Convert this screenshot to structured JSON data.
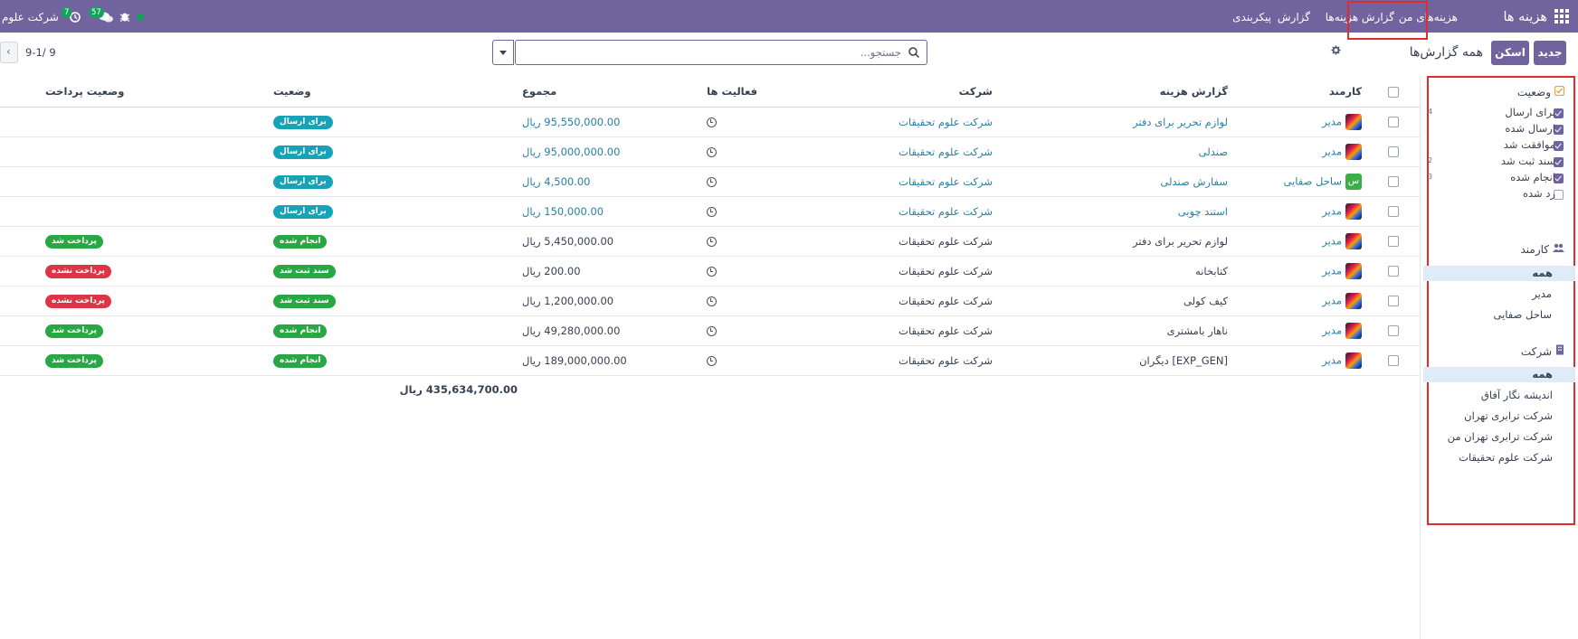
{
  "navbar": {
    "brand": "هزینه ها",
    "menu": [
      "هزینه‌های من",
      "گزارش هزینه‌ها",
      "گزارش",
      "پیکربندی"
    ],
    "company": "شرکت علوم",
    "activity_count": "7",
    "message_count": "57",
    "status_color": "#10a35a",
    "accent": "#71639e"
  },
  "control_panel": {
    "new_button": "جدید",
    "scan_button": "اسکن",
    "breadcrumb": "همه گزارش‌ها",
    "search_placeholder": "جستجو...",
    "pager": "9-1/ 9"
  },
  "table": {
    "columns": [
      "کارمند",
      "گزارش هزینه",
      "شرکت",
      "فعالیت ها",
      "مجموع",
      "وضعیت",
      "وضعیت پرداخت"
    ],
    "rows": [
      {
        "employee": "مدیر",
        "avatar": "image",
        "report": "لوازم تحریر برای دفتر",
        "company": "شرکت علوم تحقیقات",
        "total": "95,550,000.00 ریال",
        "state": "برای ارسال",
        "state_style": "info",
        "payment": "",
        "payment_style": "",
        "linked": true
      },
      {
        "employee": "مدیر",
        "avatar": "image",
        "report": "صندلی",
        "company": "شرکت علوم تحقیقات",
        "total": "95,000,000.00 ریال",
        "state": "برای ارسال",
        "state_style": "info",
        "payment": "",
        "payment_style": "",
        "linked": true
      },
      {
        "employee": "ساحل صفایی",
        "avatar": "س",
        "report": "سفارش صندلی",
        "company": "شرکت علوم تحقیقات",
        "total": "4,500.00 ریال",
        "state": "برای ارسال",
        "state_style": "info",
        "payment": "",
        "payment_style": "",
        "linked": true
      },
      {
        "employee": "مدیر",
        "avatar": "image",
        "report": "استند چوبی",
        "company": "شرکت علوم تحقیقات",
        "total": "150,000.00 ریال",
        "state": "برای ارسال",
        "state_style": "info",
        "payment": "",
        "payment_style": "",
        "linked": true
      },
      {
        "employee": "مدیر",
        "avatar": "image",
        "report": "لوازم تحریر برای دفتر",
        "company": "شرکت علوم تحقیقات",
        "total": "5,450,000.00 ریال",
        "state": "انجام شده",
        "state_style": "success",
        "payment": "پرداخت شد",
        "payment_style": "success",
        "linked": false
      },
      {
        "employee": "مدیر",
        "avatar": "image",
        "report": "کتابخانه",
        "company": "شرکت علوم تحقیقات",
        "total": "200.00 ریال",
        "state": "سند ثبت شد",
        "state_style": "success",
        "payment": "پرداخت نشده",
        "payment_style": "danger",
        "linked": false
      },
      {
        "employee": "مدیر",
        "avatar": "image",
        "report": "کیف کولی",
        "company": "شرکت علوم تحقیقات",
        "total": "1,200,000.00 ریال",
        "state": "سند ثبت شد",
        "state_style": "success",
        "payment": "پرداخت نشده",
        "payment_style": "danger",
        "linked": false
      },
      {
        "employee": "مدیر",
        "avatar": "image",
        "report": "ناهار بامشتری",
        "company": "شرکت علوم تحقیقات",
        "total": "49,280,000.00 ریال",
        "state": "انجام شده",
        "state_style": "success",
        "payment": "پرداخت شد",
        "payment_style": "success",
        "linked": false
      },
      {
        "employee": "مدیر",
        "avatar": "image",
        "report": "[EXP_GEN] دیگران",
        "company": "شرکت علوم تحقیقات",
        "total": "189,000,000.00 ریال",
        "state": "انجام شده",
        "state_style": "success",
        "payment": "پرداخت شد",
        "payment_style": "success",
        "linked": false
      }
    ],
    "grand_total": "435,634,700.00 ریال"
  },
  "search_panel": {
    "status_header": "وضعیت",
    "status_items": [
      {
        "label": "برای ارسال",
        "checked": true,
        "count": "4"
      },
      {
        "label": "ارسال شده",
        "checked": true,
        "count": ""
      },
      {
        "label": "موافقت شد",
        "checked": true,
        "count": ""
      },
      {
        "label": "سند ثبت شد",
        "checked": true,
        "count": "2"
      },
      {
        "label": "انجام شده",
        "checked": true,
        "count": "3"
      },
      {
        "label": "رد شده",
        "checked": false,
        "count": ""
      }
    ],
    "employee_header": "کارمند",
    "employee_items": [
      "همه",
      "مدیر",
      "ساحل صفایی"
    ],
    "company_header": "شرکت",
    "company_items": [
      "همه",
      "اندیشه نگار آفاق",
      "شرکت ترابری تهران",
      "شرکت ترابری تهران من",
      "شرکت علوم تحقیقات"
    ]
  }
}
